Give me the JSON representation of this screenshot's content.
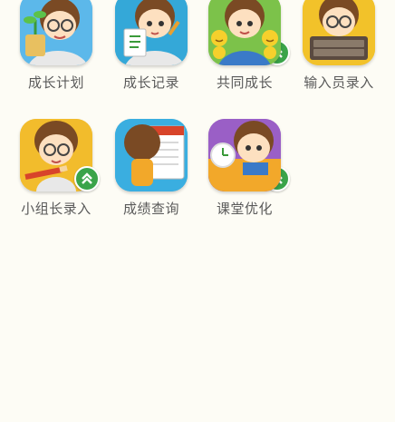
{
  "apps": [
    {
      "label": "成长计划",
      "icon": "plant-pot-icon",
      "bg": "#5cb8ea",
      "has_badge": false
    },
    {
      "label": "成长记录",
      "icon": "record-card-icon",
      "bg": "#34a8d8",
      "has_badge": true
    },
    {
      "label": "共同成长",
      "icon": "smiley-faces-icon",
      "bg": "#7cc24a",
      "has_badge": false
    },
    {
      "label": "输入员录入",
      "icon": "keyboard-icon",
      "bg": "#f2c22a",
      "has_badge": false
    },
    {
      "label": "小组长录入",
      "icon": "pencil-icon",
      "bg": "#f2bc2c",
      "has_badge": true
    },
    {
      "label": "成绩查询",
      "icon": "calendar-icon",
      "bg": "#3aaee0",
      "has_badge": true
    },
    {
      "label": "课堂优化",
      "icon": "clock-icon",
      "bg": "#9a5fc6",
      "has_badge": false
    }
  ],
  "colors": {
    "background": "#fdfcf5",
    "label_text": "#5a5a5a",
    "badge_green": "#3aa44a"
  }
}
